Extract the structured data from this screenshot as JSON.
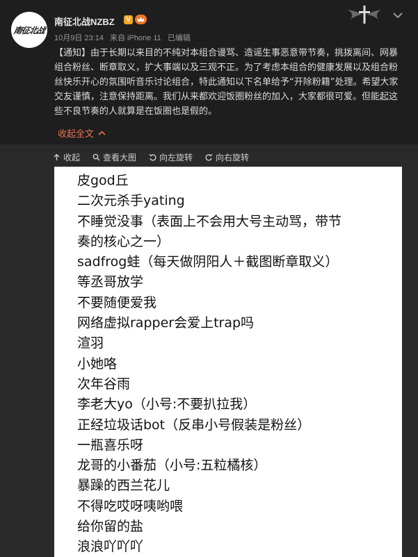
{
  "header": {
    "username": "南征北战NZBZ",
    "verified_badge": "V",
    "vip_badge": "vip-crown-icon",
    "avatar_text": "南征北战",
    "date": "10月9日 23:14",
    "source": "来自 iPhone 11",
    "edited": "已编辑"
  },
  "post": {
    "text": "【通知】由于长期以来目的不纯对本组合谩骂、造谣生事恶意带节奏，挑拨离间、网暴组合粉丝、断章取义，扩大事端以及三观不正。为了考虑本组合的健康发展以及组合粉丝快乐开心的氛围听音乐讨论组合，特此通知以下名单给予“开除粉籍”处理。希望大家交友谨慎，注意保持距离。我们从来都欢迎饭圈粉丝的加入，大家都很可爱。但能起这些不良节奏的人就算是在饭圈也是假的。",
    "collapse_label": "收起全文"
  },
  "toolbar": {
    "collapse": "收起",
    "view_large": "查看大图",
    "rotate_left": "向左旋转",
    "rotate_right": "向右旋转"
  },
  "image_list": [
    "皮god丘",
    "二次元杀手yating",
    "不睡觉没事（表面上不会用大号主动骂，带节",
    "奏的核心之一）",
    "sadfrog蛙（每天做阴阳人＋截图断章取义）",
    "等丞哥放学",
    "不要随便爱我",
    "网络虚拟rapper会爱上trap吗",
    "渲羽",
    "小她咯",
    "次年谷雨",
    "李老大yo（小号:不要扒拉我）",
    "正经垃圾话bot（反串小号假装是粉丝）",
    "一瓶喜乐呀",
    "龙哥的小番茄（小号:五粒橘核）",
    "暴躁的西兰花儿",
    "不得吃哎呀咦哟喂",
    "给你留的盐",
    "浪浪吖吖吖"
  ],
  "colors": {
    "background": "#1e1e1e",
    "panel": "#2a2a2a",
    "link_accent": "#eb7350",
    "verified": "#f5a623"
  }
}
